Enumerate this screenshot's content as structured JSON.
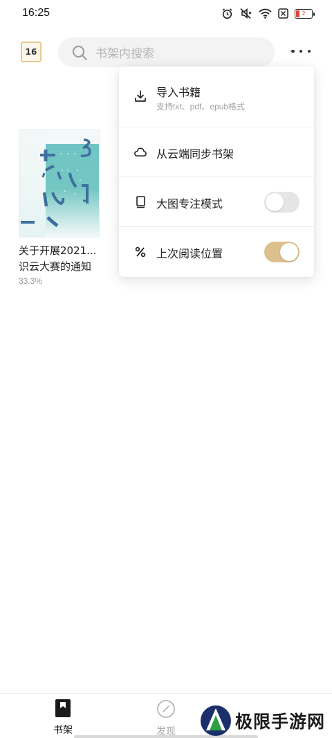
{
  "status_bar": {
    "time": "16:25",
    "battery": "2",
    "icons": [
      "alarm-icon",
      "mute-icon",
      "wifi-icon",
      "sim-off-icon",
      "battery-icon"
    ]
  },
  "header": {
    "calendar_day": "16",
    "search_placeholder": "书架内搜索",
    "more_icon": "more-dots-icon"
  },
  "shelf": {
    "books": [
      {
        "title": "关于开展2021...识云大赛的通知",
        "progress": "33.3%"
      }
    ]
  },
  "menu": {
    "items": [
      {
        "label": "导入书籍",
        "sublabel": "支持txt、pdf、epub格式",
        "icon": "download-icon"
      },
      {
        "label": "从云端同步书架",
        "icon": "cloud-icon"
      },
      {
        "label": "大图专注模式",
        "icon": "book-icon",
        "toggle": false
      },
      {
        "label": "上次阅读位置",
        "icon": "percent-icon",
        "toggle": true
      }
    ],
    "accent_color": "#dcc08e"
  },
  "bottom_nav": {
    "items": [
      {
        "label": "书架",
        "icon": "bookshelf-icon",
        "active": true
      },
      {
        "label": "发现",
        "icon": "compass-icon",
        "active": false
      }
    ]
  },
  "watermark": {
    "text": "极限手游网"
  }
}
